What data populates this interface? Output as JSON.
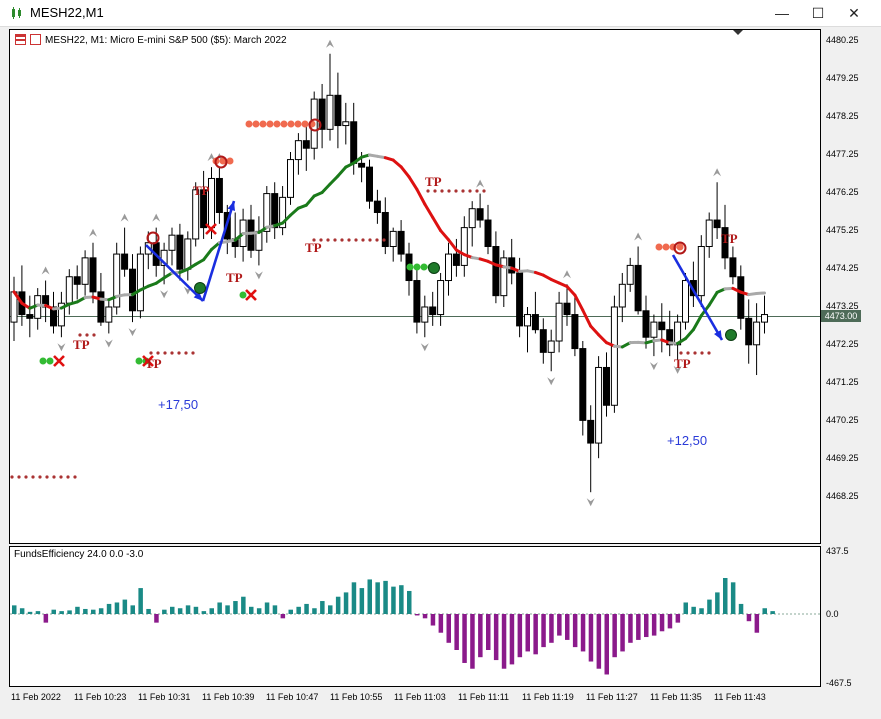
{
  "window": {
    "title": "MESH22,M1",
    "buttons": {
      "minimize": "—",
      "maximize": "☐",
      "close": "✕"
    }
  },
  "chart": {
    "header": "MESH22, M1:  Micro E-mini S&P 500 ($5): March 2022",
    "current_price_label": "4473.00",
    "price_axis": [
      "4480.25",
      "4479.25",
      "4478.25",
      "4477.25",
      "4476.25",
      "4475.25",
      "4474.25",
      "4473.25",
      "4472.25",
      "4471.25",
      "4470.25",
      "4469.25",
      "4468.25"
    ],
    "time_axis": [
      "11 Feb 2022",
      "11 Feb 10:23",
      "11 Feb 10:31",
      "11 Feb 10:39",
      "11 Feb 10:47",
      "11 Feb 10:55",
      "11 Feb 11:03",
      "11 Feb 11:11",
      "11 Feb 11:19",
      "11 Feb 11:27",
      "11 Feb 11:35",
      "11 Feb 11:43"
    ],
    "annotations": {
      "profit_1": "+17,50",
      "profit_2": "+12,50",
      "tp_label": "TP"
    }
  },
  "indicator": {
    "header": "FundsEfficiency 24.0 0.0 -3.0",
    "axis": [
      "437.5",
      "0.0",
      "-467.5"
    ]
  },
  "colors": {
    "bull_candle": "#ffffff",
    "bear_candle": "#000000",
    "ma_neutral": "#a9a9a9",
    "ma_up": "#1a7a1a",
    "ma_down": "#dd1111",
    "positive_hist": "#1a8a86",
    "negative_hist": "#8b1a8b",
    "tp_color": "#b01818",
    "signal_arrow": "#1a2ee0",
    "price_line": "#4e6b58"
  },
  "chart_data": {
    "type": "candlestick",
    "symbol": "MESH22",
    "timeframe": "M1",
    "ylim": [
      4467.9,
      4480.5
    ],
    "series": [
      {
        "name": "MESH22",
        "ohlc": [
          [
            4472.8,
            4474.0,
            4472.3,
            4473.6
          ],
          [
            4473.6,
            4474.3,
            4472.7,
            4473.0
          ],
          [
            4473.0,
            4473.5,
            4472.4,
            4472.9
          ],
          [
            4472.9,
            4473.7,
            4472.6,
            4473.5
          ],
          [
            4473.5,
            4473.9,
            4472.8,
            4473.2
          ],
          [
            4473.2,
            4473.6,
            4472.5,
            4472.7
          ],
          [
            4472.7,
            4473.6,
            4472.4,
            4473.3
          ],
          [
            4473.3,
            4474.2,
            4473.0,
            4474.0
          ],
          [
            4474.0,
            4474.3,
            4473.4,
            4473.8
          ],
          [
            4473.8,
            4474.7,
            4473.5,
            4474.5
          ],
          [
            4474.5,
            4474.9,
            4473.3,
            4473.6
          ],
          [
            4473.6,
            4474.1,
            4472.7,
            4472.8
          ],
          [
            4472.8,
            4473.4,
            4472.5,
            4473.2
          ],
          [
            4473.2,
            4474.9,
            4473.0,
            4474.6
          ],
          [
            4474.6,
            4475.3,
            4474.0,
            4474.2
          ],
          [
            4474.2,
            4474.6,
            4472.8,
            4473.1
          ],
          [
            4473.1,
            4474.8,
            4472.9,
            4474.6
          ],
          [
            4474.6,
            4475.2,
            4474.2,
            4474.9
          ],
          [
            4474.9,
            4475.3,
            4474.0,
            4474.3
          ],
          [
            4474.3,
            4474.9,
            4473.8,
            4474.7
          ],
          [
            4474.7,
            4475.3,
            4474.3,
            4475.1
          ],
          [
            4475.1,
            4475.4,
            4473.9,
            4474.2
          ],
          [
            4474.2,
            4475.2,
            4473.9,
            4475.0
          ],
          [
            4475.0,
            4476.5,
            4474.8,
            4476.3
          ],
          [
            4476.3,
            4476.8,
            4475.0,
            4475.3
          ],
          [
            4475.3,
            4476.9,
            4475.0,
            4476.6
          ],
          [
            4476.6,
            4476.9,
            4475.4,
            4475.7
          ],
          [
            4475.7,
            4475.9,
            4474.6,
            4475.0
          ],
          [
            4475.0,
            4475.7,
            4474.5,
            4474.8
          ],
          [
            4474.8,
            4475.8,
            4474.4,
            4475.5
          ],
          [
            4475.5,
            4475.9,
            4474.5,
            4474.7
          ],
          [
            4474.7,
            4475.6,
            4474.3,
            4475.2
          ],
          [
            4475.2,
            4476.4,
            4474.9,
            4476.2
          ],
          [
            4476.2,
            4476.5,
            4475.0,
            4475.3
          ],
          [
            4475.3,
            4476.4,
            4475.1,
            4476.1
          ],
          [
            4476.1,
            4477.3,
            4475.9,
            4477.1
          ],
          [
            4477.1,
            4477.8,
            4476.7,
            4477.6
          ],
          [
            4477.6,
            4478.0,
            4476.8,
            4477.4
          ],
          [
            4477.4,
            4478.9,
            4477.1,
            4478.7
          ],
          [
            4478.7,
            4479.1,
            4477.4,
            4477.9
          ],
          [
            4477.9,
            4479.9,
            4477.6,
            4478.8
          ],
          [
            4478.8,
            4479.4,
            4477.4,
            4478.0
          ],
          [
            4478.0,
            4478.6,
            4477.5,
            4478.1
          ],
          [
            4478.1,
            4478.6,
            4476.7,
            4477.0
          ],
          [
            4477.0,
            4477.3,
            4476.5,
            4476.9
          ],
          [
            4476.9,
            4477.1,
            4475.8,
            4476.0
          ],
          [
            4476.0,
            4476.3,
            4475.4,
            4475.7
          ],
          [
            4475.7,
            4476.1,
            4474.6,
            4474.8
          ],
          [
            4474.8,
            4475.3,
            4474.4,
            4475.2
          ],
          [
            4475.2,
            4475.5,
            4474.4,
            4474.6
          ],
          [
            4474.6,
            4474.9,
            4473.5,
            4473.9
          ],
          [
            4473.9,
            4474.3,
            4472.5,
            4472.8
          ],
          [
            4472.8,
            4473.5,
            4472.4,
            4473.2
          ],
          [
            4473.2,
            4473.6,
            4472.7,
            4473.0
          ],
          [
            4473.0,
            4474.1,
            4472.7,
            4473.9
          ],
          [
            4473.9,
            4474.9,
            4473.5,
            4474.6
          ],
          [
            4474.6,
            4475.0,
            4474.0,
            4474.3
          ],
          [
            4474.3,
            4475.6,
            4474.0,
            4475.3
          ],
          [
            4475.3,
            4476.0,
            4474.8,
            4475.8
          ],
          [
            4475.8,
            4476.2,
            4475.3,
            4475.5
          ],
          [
            4475.5,
            4475.9,
            4474.6,
            4474.8
          ],
          [
            4474.8,
            4475.2,
            4473.3,
            4473.5
          ],
          [
            4473.5,
            4474.7,
            4473.2,
            4474.5
          ],
          [
            4474.5,
            4475.0,
            4473.8,
            4474.1
          ],
          [
            4474.1,
            4474.5,
            4472.4,
            4472.7
          ],
          [
            4472.7,
            4473.2,
            4472.0,
            4473.0
          ],
          [
            4473.0,
            4473.6,
            4472.5,
            4472.6
          ],
          [
            4472.6,
            4472.9,
            4471.7,
            4472.0
          ],
          [
            4472.0,
            4472.6,
            4471.5,
            4472.3
          ],
          [
            4472.3,
            4473.6,
            4472.0,
            4473.3
          ],
          [
            4473.3,
            4473.8,
            4472.7,
            4473.0
          ],
          [
            4473.0,
            4473.5,
            4471.9,
            4472.1
          ],
          [
            4472.1,
            4472.3,
            4469.8,
            4470.2
          ],
          [
            4470.2,
            4470.6,
            4468.3,
            4469.6
          ],
          [
            4469.6,
            4471.9,
            4469.2,
            4471.6
          ],
          [
            4471.6,
            4472.0,
            4470.3,
            4470.6
          ],
          [
            4470.6,
            4473.5,
            4470.4,
            4473.2
          ],
          [
            4473.2,
            4474.1,
            4472.8,
            4473.8
          ],
          [
            4473.8,
            4474.5,
            4473.6,
            4474.3
          ],
          [
            4474.3,
            4474.8,
            4473.0,
            4473.1
          ],
          [
            4473.1,
            4473.5,
            4472.1,
            4472.4
          ],
          [
            4472.4,
            4473.0,
            4471.9,
            4472.8
          ],
          [
            4472.8,
            4473.3,
            4472.0,
            4472.6
          ],
          [
            4472.6,
            4473.1,
            4471.9,
            4472.2
          ],
          [
            4472.2,
            4473.0,
            4471.8,
            4472.8
          ],
          [
            4472.8,
            4474.1,
            4472.6,
            4473.9
          ],
          [
            4473.9,
            4474.4,
            4473.2,
            4473.5
          ],
          [
            4473.5,
            4475.1,
            4473.2,
            4474.8
          ],
          [
            4474.8,
            4475.7,
            4474.5,
            4475.5
          ],
          [
            4475.5,
            4476.5,
            4475.0,
            4475.3
          ],
          [
            4475.3,
            4475.9,
            4474.2,
            4474.5
          ],
          [
            4474.5,
            4474.8,
            4473.8,
            4474.0
          ],
          [
            4474.0,
            4474.3,
            4472.6,
            4472.9
          ],
          [
            4472.9,
            4473.4,
            4471.7,
            4472.2
          ],
          [
            4472.2,
            4473.3,
            4471.4,
            4472.8
          ],
          [
            4472.8,
            4473.5,
            4472.5,
            4473.0
          ]
        ]
      }
    ]
  },
  "indicator_data": {
    "type": "histogram",
    "ylim": [
      -467.5,
      437.5
    ],
    "values": [
      60,
      40,
      15,
      20,
      -60,
      30,
      20,
      25,
      50,
      35,
      30,
      40,
      70,
      80,
      100,
      60,
      180,
      35,
      -60,
      30,
      50,
      40,
      60,
      50,
      20,
      40,
      80,
      60,
      90,
      120,
      50,
      40,
      80,
      60,
      -30,
      30,
      50,
      70,
      40,
      90,
      60,
      120,
      150,
      220,
      180,
      240,
      220,
      230,
      190,
      200,
      160,
      -10,
      -30,
      -80,
      -130,
      -200,
      -250,
      -340,
      -380,
      -300,
      -250,
      -320,
      -380,
      -350,
      -300,
      -260,
      -280,
      -230,
      -200,
      -150,
      -180,
      -230,
      -260,
      -330,
      -380,
      -420,
      -300,
      -260,
      -200,
      -180,
      -160,
      -150,
      -120,
      -100,
      -60,
      80,
      50,
      40,
      100,
      150,
      250,
      220,
      70,
      -50,
      -130,
      40,
      20
    ]
  }
}
